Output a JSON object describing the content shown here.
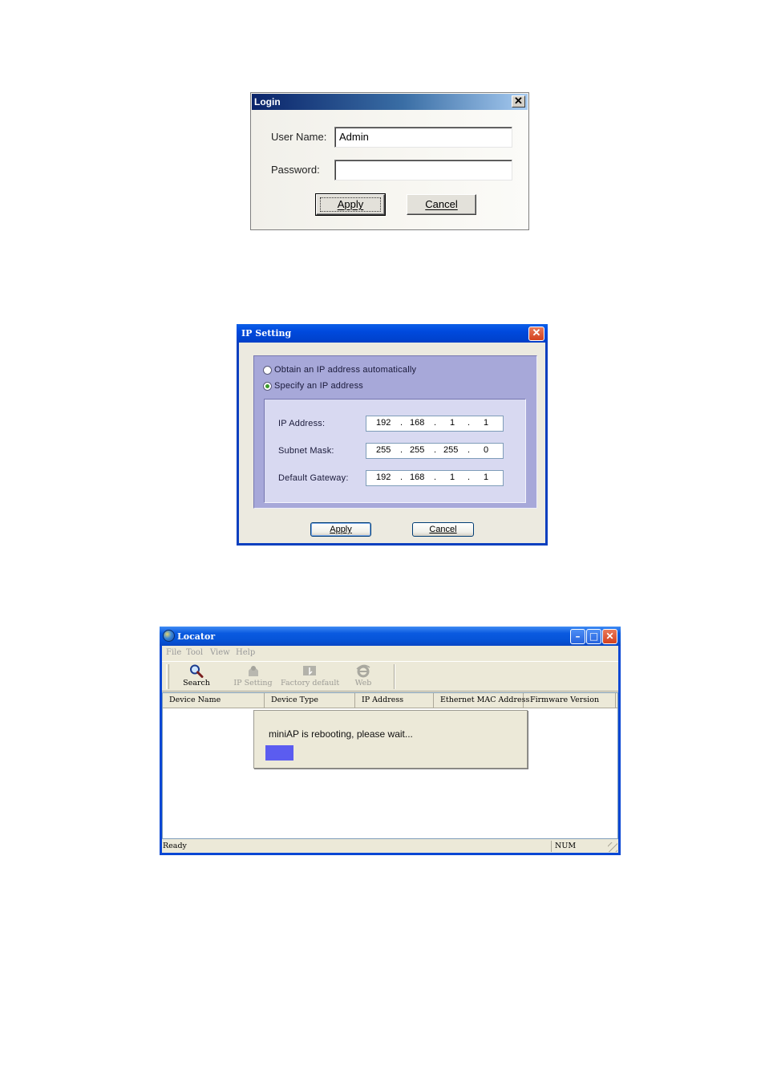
{
  "login": {
    "title": "Login",
    "close_glyph": "✕",
    "username_label": "User Name:",
    "username_value": "Admin",
    "password_label": "Password:",
    "password_value": "",
    "apply_label": "Apply",
    "cancel_label": "Cancel"
  },
  "ip_setting": {
    "title": "IP Setting",
    "close_glyph": "✕",
    "radio_auto_label": "Obtain an IP address automatically",
    "radio_manual_label": "Specify an IP address",
    "selected_option": "manual",
    "ip_address": {
      "label": "IP Address:",
      "octets": [
        "192",
        "168",
        "1",
        "1"
      ]
    },
    "subnet_mask": {
      "label": "Subnet Mask:",
      "octets": [
        "255",
        "255",
        "255",
        "0"
      ]
    },
    "default_gateway": {
      "label": "Default Gateway:",
      "octets": [
        "192",
        "168",
        "1",
        "1"
      ]
    },
    "octet_separator": ".",
    "apply_label": "Apply",
    "cancel_label": "Cancel"
  },
  "locator": {
    "title": "Locator",
    "app_icon": "globe-icon",
    "window_buttons": {
      "minimize": "–",
      "maximize": "□",
      "close": "✕"
    },
    "menu": [
      "File",
      "Tool",
      "View",
      "Help"
    ],
    "toolbar": [
      {
        "label": "Search",
        "icon": "magnifier-icon",
        "enabled": true
      },
      {
        "label": "IP Setting",
        "icon": "gear-icon",
        "enabled": false
      },
      {
        "label": "Factory default",
        "icon": "reset-icon",
        "enabled": false
      },
      {
        "label": "Web",
        "icon": "ie-icon",
        "enabled": false
      }
    ],
    "columns": [
      "Device Name",
      "Device Type",
      "IP Address",
      "Ethernet MAC Address",
      "Firmware Version"
    ],
    "progress": {
      "message": "miniAP is rebooting, please wait...",
      "value_fraction": 0.11,
      "color": "#5b5cf0"
    },
    "status": {
      "text": "Ready",
      "num_indicator": "NUM"
    }
  }
}
